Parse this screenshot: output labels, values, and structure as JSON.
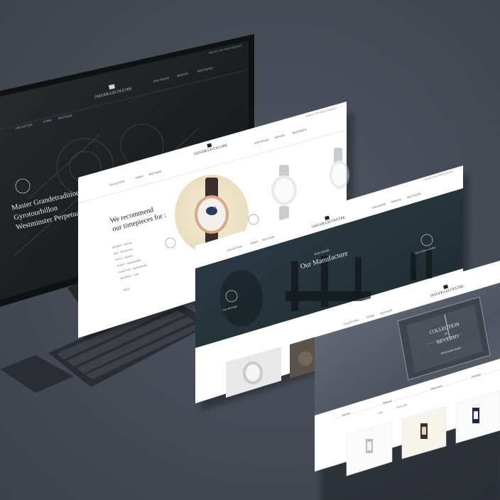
{
  "brand": {
    "name": "JAEGER-LECOULTRE"
  },
  "monitor": {
    "top_links": [
      "SEARCH",
      "MY PAGE",
      "CONTACT"
    ],
    "nav_items": [
      "OUR HOUSE",
      "SERVICE",
      "BOUTIQUES"
    ],
    "left_nav": [
      "COLLECTION",
      "STRAP",
      "BOUTIQUE"
    ],
    "hero_title_lines": [
      "Master Grandetradition",
      "Gyrotourbillon",
      "Westminster Perpetual"
    ]
  },
  "page_recommend": {
    "top_links": [
      "SEARCH",
      "MY PAGE",
      "CONTACT"
    ],
    "nav_items": [
      "OUR HOUSE",
      "SERVICE",
      "BOUTIQUES"
    ],
    "left_nav": [
      "COLLECTION",
      "STRAP",
      "BOUTIQUE"
    ],
    "heading_lines": [
      "We recommend",
      "our timepieces for :"
    ],
    "filters": [
      "GENDER : Woman",
      "AGE : 30 and over",
      "STYLE : Modern",
      "STORY : Sophisticated",
      "FUNCTION : Date/calendar",
      "MATERIAL : Gold"
    ],
    "back_label": "BACK"
  },
  "page_manufacture": {
    "top_links": [
      "SEARCH",
      "MY PAGE",
      "CONTACT"
    ],
    "nav_items": [
      "OUR HOUSE",
      "SERVICE",
      "BOUTIQUES"
    ],
    "left_nav": [
      "COLLECTION",
      "STRAP",
      "BOUTIQUE"
    ],
    "kicker": "OUR HOUSE",
    "title": "Our Manufacture",
    "left_label": "Our Heritage",
    "right_label": "Our Craftsmanship"
  },
  "page_reverso": {
    "nav_items": [
      "OUR HOUSE",
      "SERVICE",
      "BOUTIQUES"
    ],
    "left_nav": [
      "COLLECTION",
      "STRAP",
      "BOUTIQUE"
    ],
    "collection_label": "COLLECTION",
    "of_label": "OF",
    "name": "REVERSO",
    "cta": "DISCOVER MORE",
    "filters": [
      "Gender",
      "Material",
      "Movement",
      "Function"
    ],
    "sub_filters": [
      "Lady",
      "Rose gold"
    ]
  },
  "colors": {
    "background": "#484d58",
    "screen_dark": "#1c1e22",
    "page_white": "#ffffff",
    "teal_dark": "#2d3f47",
    "accent_gold": "#c8a55a"
  }
}
